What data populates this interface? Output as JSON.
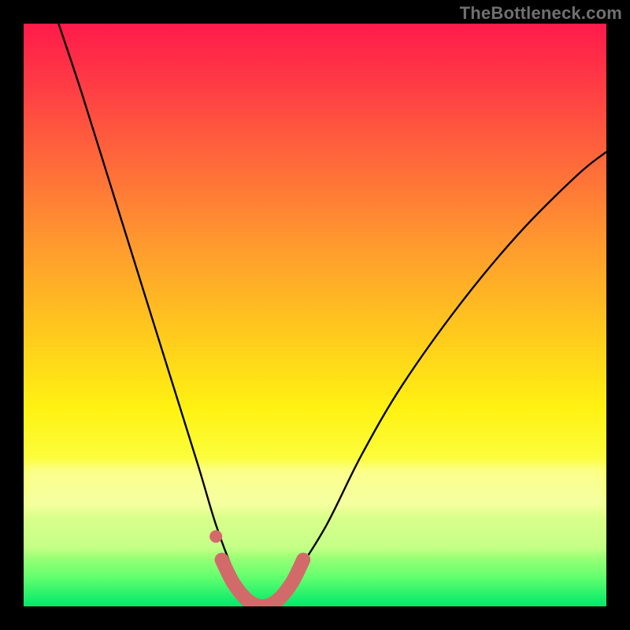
{
  "watermark": "TheBottleneck.com",
  "colors": {
    "gradient_top": "#ff1a4a",
    "gradient_bottom": "#00e86a",
    "curve": "#000000",
    "marker": "#d36a6a",
    "background": "#000000",
    "watermark_text": "#707070"
  },
  "chart_data": {
    "type": "line",
    "title": "",
    "xlabel": "",
    "ylabel": "",
    "xlim": [
      0,
      100
    ],
    "ylim": [
      0,
      100
    ],
    "series": [
      {
        "name": "bottleneck-curve",
        "x": [
          6,
          10,
          15,
          20,
          25,
          30,
          33,
          36,
          38,
          40,
          42,
          44,
          47,
          52,
          58,
          65,
          75,
          85,
          95,
          100
        ],
        "y": [
          100,
          88,
          72,
          56,
          40,
          24,
          14,
          6,
          2,
          0,
          0,
          2,
          6,
          14,
          26,
          38,
          52,
          64,
          74,
          78
        ]
      }
    ],
    "marker": {
      "name": "highlight-band",
      "x": [
        34,
        36,
        38.5,
        41,
        43.5,
        46,
        48
      ],
      "y": [
        8,
        4,
        1,
        0,
        1,
        4,
        8
      ],
      "isolated_dot": {
        "x": 33,
        "y": 12
      }
    },
    "background_gradient": {
      "type": "vertical",
      "stops": [
        {
          "pos": 0.0,
          "color": "#ff1a4a"
        },
        {
          "pos": 0.24,
          "color": "#ff6a3a"
        },
        {
          "pos": 0.52,
          "color": "#ffc61e"
        },
        {
          "pos": 0.76,
          "color": "#fbff43"
        },
        {
          "pos": 0.9,
          "color": "#b6ff7a"
        },
        {
          "pos": 1.0,
          "color": "#00e86a"
        }
      ]
    }
  }
}
